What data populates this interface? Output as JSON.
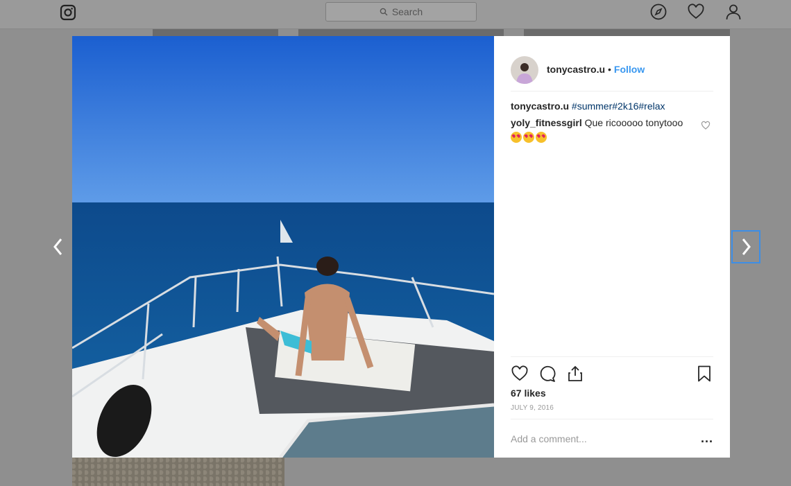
{
  "header": {
    "search_placeholder": "Search"
  },
  "post": {
    "username": "tonycastro.u",
    "separator": "•",
    "follow_label": "Follow",
    "caption_user": "tonycastro.u",
    "caption_tags": "#summer#2k16#relax",
    "comment_user": "yoly_fitnessgirl",
    "comment_text": "Que ricooooo tonytooo",
    "likes": "67 likes",
    "date": "JULY 9, 2016",
    "add_comment_placeholder": "Add a comment...",
    "more_label": "..."
  }
}
